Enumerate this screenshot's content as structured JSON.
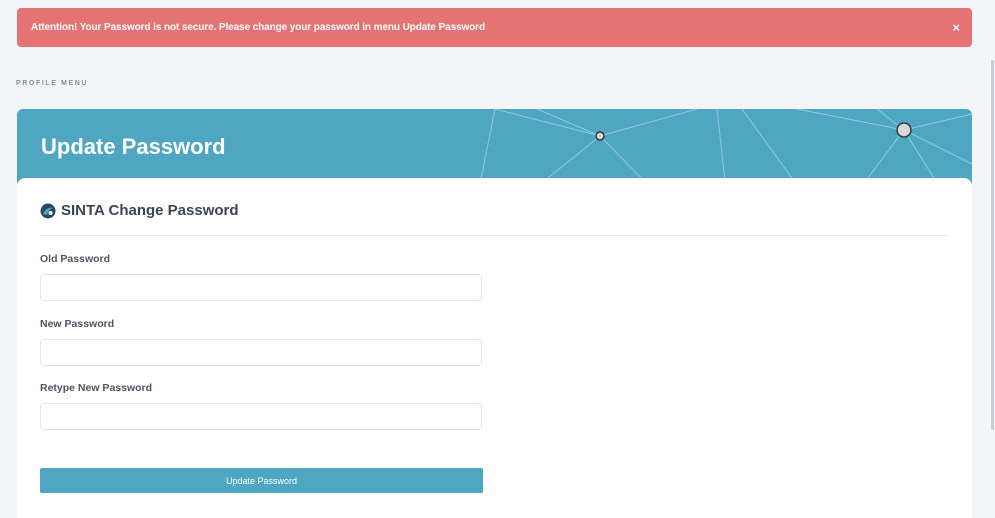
{
  "alert": {
    "message": "Attention! Your Password is not secure. Please change your password in menu Update Password",
    "close_label": "×",
    "color": "#e57373"
  },
  "section_label": "PROFILE MENU",
  "banner": {
    "title": "Update Password",
    "color": "#4fa6c2"
  },
  "card": {
    "title": "SINTA Change Password",
    "logo_icon": "sinta-logo-icon"
  },
  "form": {
    "old_password": {
      "label": "Old Password",
      "value": "",
      "placeholder": ""
    },
    "new_password": {
      "label": "New Password",
      "value": "",
      "placeholder": ""
    },
    "retype_password": {
      "label": "Retype New Password",
      "value": "",
      "placeholder": ""
    },
    "submit_label": "Update Password"
  }
}
